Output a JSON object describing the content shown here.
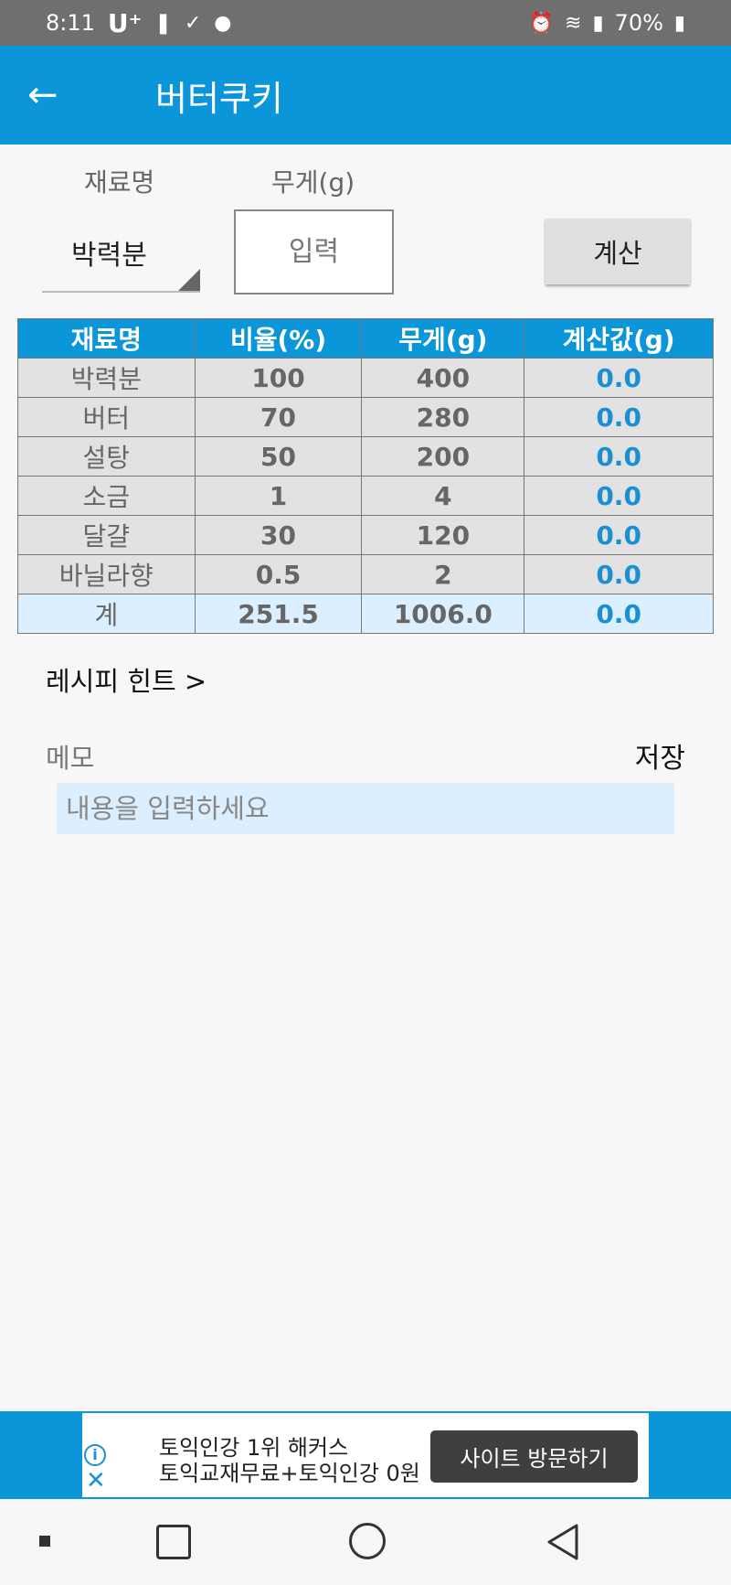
{
  "status_bar": {
    "time": "8:11",
    "carrier": "U⁺",
    "battery": "70%"
  },
  "app_bar": {
    "back_icon": "arrow-left-icon",
    "title": "버터쿠키"
  },
  "form": {
    "ingredient_label": "재료명",
    "weight_label": "무게(g)",
    "selected_ingredient": "박력분",
    "weight_placeholder": "입력",
    "calc_button": "계산"
  },
  "table": {
    "headers": [
      "재료명",
      "비율(%)",
      "무게(g)",
      "계산값(g)"
    ],
    "rows": [
      {
        "name": "박력분",
        "ratio": "100",
        "weight": "400",
        "calc": "0.0"
      },
      {
        "name": "버터",
        "ratio": "70",
        "weight": "280",
        "calc": "0.0"
      },
      {
        "name": "설탕",
        "ratio": "50",
        "weight": "200",
        "calc": "0.0"
      },
      {
        "name": "소금",
        "ratio": "1",
        "weight": "4",
        "calc": "0.0"
      },
      {
        "name": "달걀",
        "ratio": "30",
        "weight": "120",
        "calc": "0.0"
      },
      {
        "name": "바닐라향",
        "ratio": "0.5",
        "weight": "2",
        "calc": "0.0"
      }
    ],
    "total": {
      "name": "계",
      "ratio": "251.5",
      "weight": "1006.0",
      "calc": "0.0"
    }
  },
  "hint_link": "레시피 힌트 >",
  "memo": {
    "label": "메모",
    "save": "저장",
    "placeholder": "내용을 입력하세요"
  },
  "ad": {
    "line1": "토익인강 1위 해커스",
    "line2": "토익교재무료+토익인강 0원",
    "cta": "사이트 방문하기"
  },
  "colors": {
    "primary": "#0a96d8",
    "calc_value": "#1a8fd2",
    "total_row": "#dcefff"
  }
}
